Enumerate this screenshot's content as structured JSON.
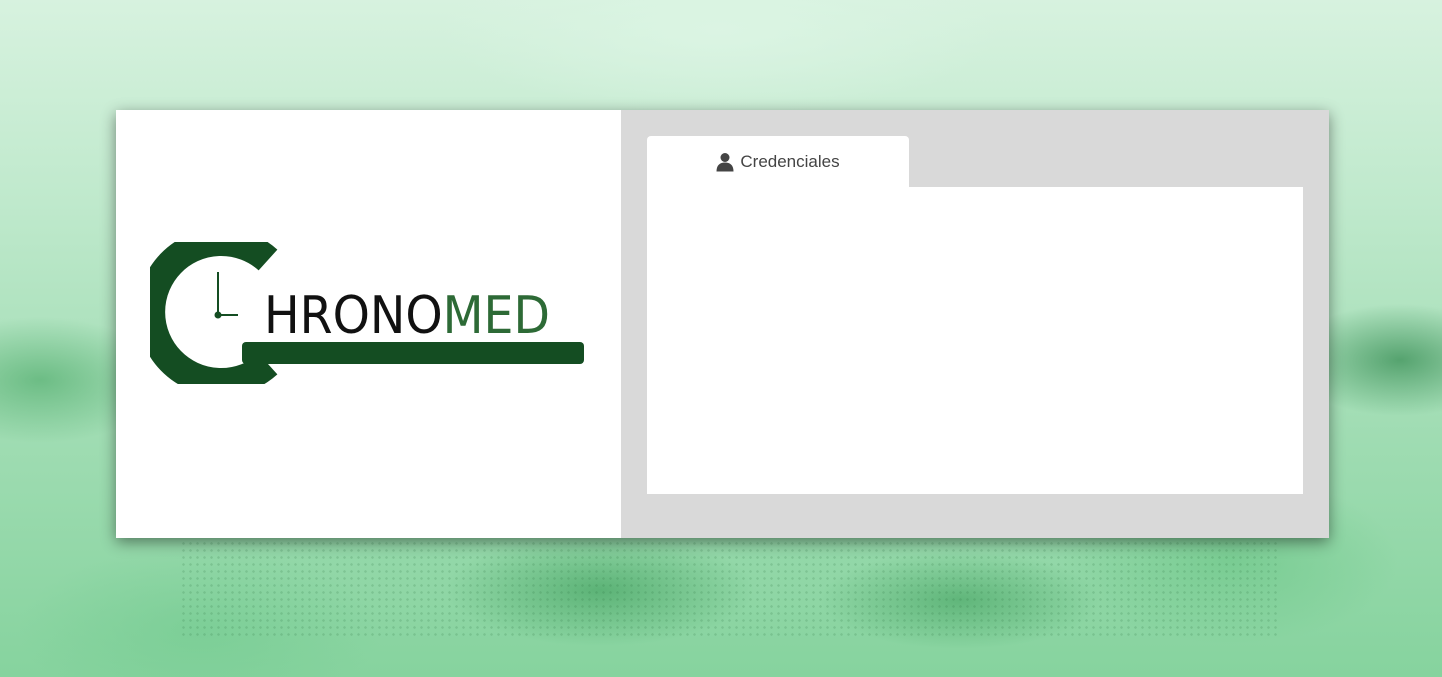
{
  "brand": {
    "logo_text_dark": "HRONO",
    "logo_text_light": "MED",
    "logo_color": "#144d22",
    "icon": "clock-c-icon"
  },
  "tabs": [
    {
      "label": "Credenciales",
      "icon": "user-icon",
      "active": true
    }
  ],
  "colors": {
    "panel_grey": "#d9d9d9",
    "tab_text": "#444444",
    "background_tint": "#9fdcb2"
  }
}
